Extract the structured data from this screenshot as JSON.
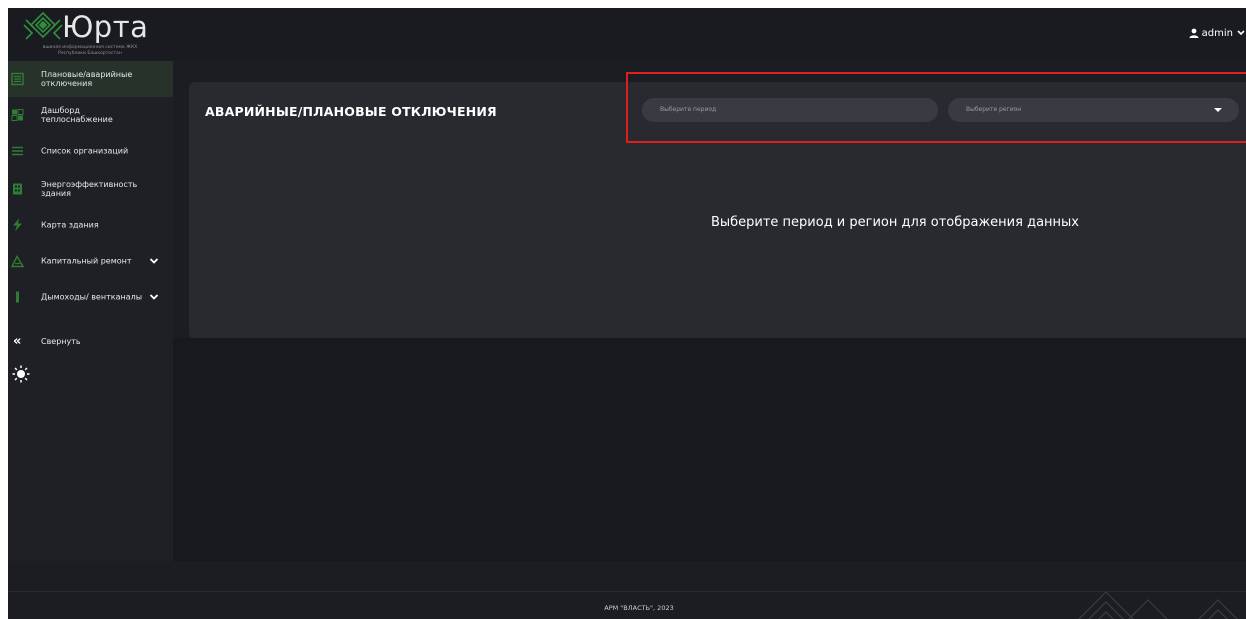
{
  "header": {
    "logo_title": "Юрта",
    "logo_subtitle_line1": "вшиная информационная система ЖКХ",
    "logo_subtitle_line2": "Республики Башкортостан",
    "user_name": "admin"
  },
  "sidebar": {
    "items": [
      {
        "label": "Плановые/аварийные отключения",
        "icon": "outage-icon"
      },
      {
        "label": "Дашборд теплоснабжение",
        "icon": "dashboard-icon"
      },
      {
        "label": "Список организаций",
        "icon": "list-icon"
      },
      {
        "label": "Энергоэффективность здания",
        "icon": "building-icon"
      },
      {
        "label": "Карта здания",
        "icon": "lightning-icon"
      },
      {
        "label": "Капитальный ремонт",
        "icon": "repair-icon"
      },
      {
        "label": "Дымоходы/ вентканалы",
        "icon": "chimney-icon"
      }
    ],
    "collapse_label": "Свернуть"
  },
  "main": {
    "title": "АВАРИЙНЫЕ/ПЛАНОВЫЕ ОТКЛЮЧЕНИЯ",
    "period_placeholder": "Выберите период",
    "region_placeholder": "Выберите регион",
    "empty_message": "Выберите период и регион для отображения данных"
  },
  "footer": {
    "text": "АРМ \"ВЛАСТЬ\", 2023"
  },
  "colors": {
    "accent_green": "#2e7d32",
    "highlight_red": "#e01e1e",
    "background": "#1c1d22"
  }
}
